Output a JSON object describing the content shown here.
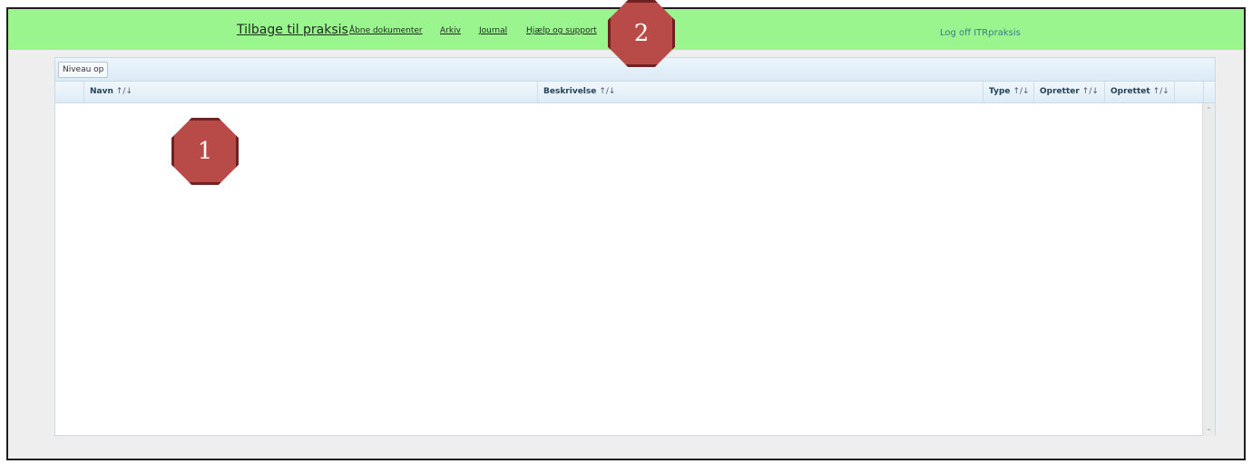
{
  "nav": {
    "back_label": "Tilbage til praksis",
    "links": [
      "Åbne dokumenter",
      "Arkiv",
      "Journal",
      "Hjælp og support"
    ],
    "logoff_label": "Log off ITRpraksis"
  },
  "badges": [
    "1",
    "2"
  ],
  "toolbar": {
    "up_label": "Niveau op"
  },
  "table": {
    "columns": [
      "Navn",
      "Beskrivelse",
      "Type",
      "Opretter",
      "Oprettet"
    ],
    "sort_indicator": "↑/↓",
    "rows": []
  },
  "colors": {
    "topbar": "#9af58f",
    "badge": "#b84a48",
    "header": "#dfecf6",
    "background": "#eeeeee"
  }
}
